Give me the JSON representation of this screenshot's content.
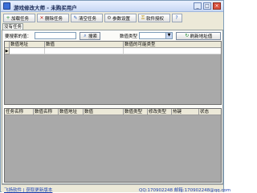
{
  "window": {
    "title": "游戏修改大师 - 未购买用户",
    "minimize": "_",
    "maximize": "□",
    "close": "×"
  },
  "toolbar": {
    "items": [
      {
        "label": "加载任务",
        "icon": "add-icon"
      },
      {
        "label": "删除任务",
        "icon": "delete-icon"
      },
      {
        "label": "清空任务",
        "icon": "clear-icon"
      },
      {
        "label": "参数设置",
        "icon": "settings-icon"
      },
      {
        "label": "软件授权",
        "icon": "key-icon"
      },
      {
        "label": "",
        "icon": "help-icon"
      }
    ]
  },
  "tabs": [
    {
      "label": "没有任务"
    }
  ],
  "search": {
    "label": "要搜索的值：",
    "value": "",
    "search_button": "搜索",
    "type_label": "数值类型",
    "type_value": "",
    "refresh_button": "刷新地址值"
  },
  "results_table": {
    "columns": [
      "数值地址",
      "数值",
      "数值的可能类型"
    ]
  },
  "tasks_table": {
    "columns": [
      "任务名称",
      "数值名称",
      "数值地址",
      "数值",
      "数值类型",
      "修改类型",
      "热键",
      "状态"
    ]
  },
  "status": {
    "left": "飞扬软件 | 获取更新版本",
    "right": "QQ:170902248   邮箱:170902248@qq.com"
  },
  "colors": {
    "titlebar": "#c8d8f4",
    "window_bg": "#ece9d8",
    "grid_bg": "#a9a9a9",
    "status_link": "#1a3fb0"
  }
}
